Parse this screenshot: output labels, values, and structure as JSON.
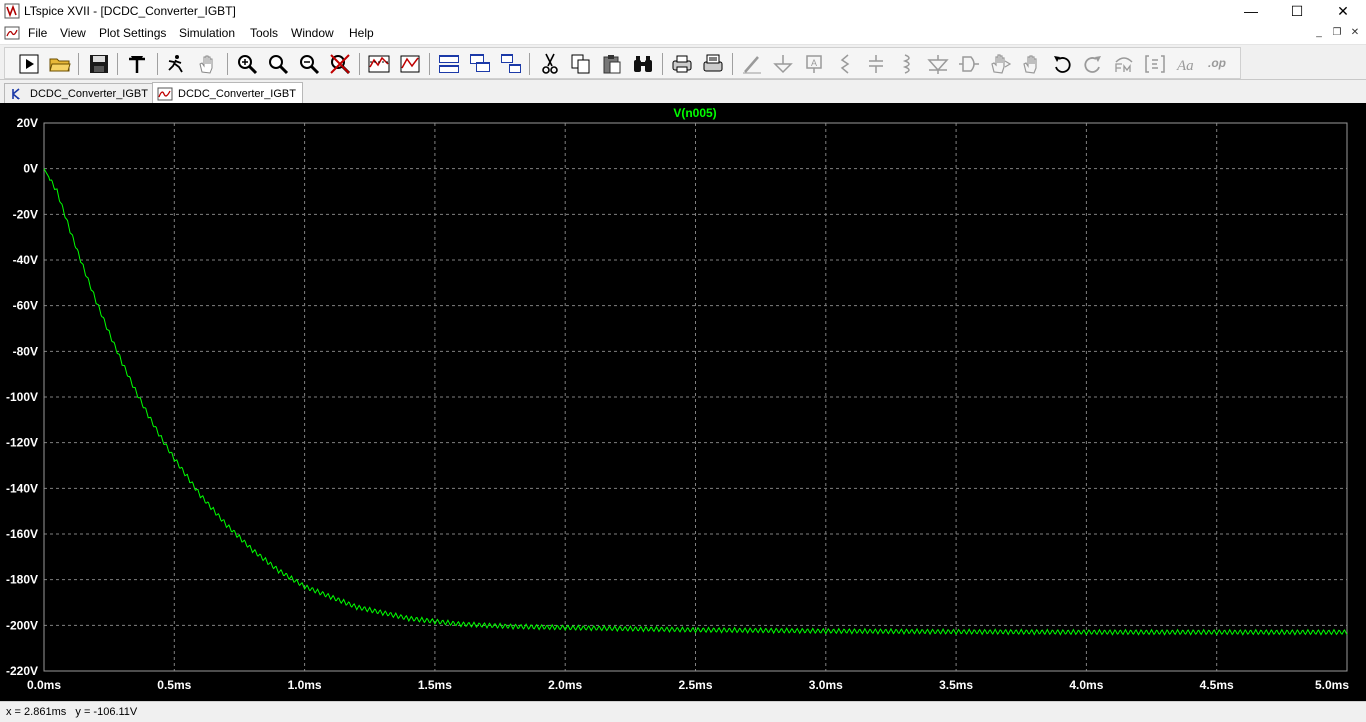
{
  "window": {
    "title": "LTspice XVII - [DCDC_Converter_IGBT]",
    "controls": {
      "minimize": "—",
      "maximize": "☐",
      "close": "✕"
    },
    "mdi_controls": {
      "minimize": "_",
      "restore": "❐",
      "close": "✕"
    }
  },
  "menu": {
    "items": [
      {
        "id": "file",
        "label": "File"
      },
      {
        "id": "view",
        "label": "View"
      },
      {
        "id": "plot-settings",
        "label": "Plot Settings"
      },
      {
        "id": "simulation",
        "label": "Simulation"
      },
      {
        "id": "tools",
        "label": "Tools"
      },
      {
        "id": "window",
        "label": "Window"
      },
      {
        "id": "help",
        "label": "Help"
      }
    ]
  },
  "toolbar": {
    "icons": [
      "run-icon",
      "open-folder-icon",
      "save-icon",
      "control-panel-icon",
      "halt-icon",
      "pan-hand-icon",
      "zoom-in-icon",
      "zoom-area-icon",
      "zoom-out-icon",
      "zoom-cancel-icon",
      "autorange-icon",
      "zoom-fit-icon",
      "tile-horizontal-icon",
      "cascade-icon",
      "tile-vertical-icon",
      "cut-icon",
      "copy-icon",
      "paste-icon",
      "find-icon",
      "print-icon",
      "print-setup-icon",
      "wire-icon",
      "ground-icon",
      "label-icon",
      "resistor-icon",
      "capacitor-icon",
      "inductor-icon",
      "diode-icon",
      "component-icon",
      "move-icon",
      "drag-icon",
      "undo-icon",
      "redo-icon",
      "rotate-icon",
      "mirror-icon",
      "text-icon",
      "spice-directive-icon"
    ]
  },
  "tabs": [
    {
      "label": "DCDC_Converter_IGBT",
      "icon": "schematic-icon",
      "active": false
    },
    {
      "label": "DCDC_Converter_IGBT",
      "icon": "waveform-icon",
      "active": true
    }
  ],
  "chart_data": {
    "type": "line",
    "title": "V(n005)",
    "xlabel": "",
    "ylabel": "",
    "xlim": [
      0,
      5.0
    ],
    "ylim": [
      -220,
      20
    ],
    "x_unit": "ms",
    "y_unit": "V",
    "x_ticks": [
      "0.0ms",
      "0.5ms",
      "1.0ms",
      "1.5ms",
      "2.0ms",
      "2.5ms",
      "3.0ms",
      "3.5ms",
      "4.0ms",
      "4.5ms",
      "5.0ms"
    ],
    "y_ticks": [
      "20V",
      "0V",
      "-20V",
      "-40V",
      "-60V",
      "-80V",
      "-100V",
      "-120V",
      "-140V",
      "-160V",
      "-180V",
      "-200V",
      "-220V"
    ],
    "grid": true,
    "background": "#000000",
    "grid_color": "#808080",
    "series": [
      {
        "name": "V(n005)",
        "color": "#00ff00",
        "x": [
          0,
          0.05,
          0.1,
          0.15,
          0.2,
          0.25,
          0.3,
          0.35,
          0.4,
          0.45,
          0.5,
          0.6,
          0.7,
          0.8,
          0.9,
          1.0,
          1.2,
          1.4,
          1.6,
          1.8,
          2.0,
          2.5,
          3.0,
          3.5,
          4.0,
          4.5,
          5.0
        ],
        "values": [
          0,
          -10,
          -27,
          -43,
          -58,
          -72,
          -85,
          -97,
          -108,
          -118,
          -127,
          -143,
          -156,
          -167,
          -176,
          -183,
          -192,
          -197,
          -199.5,
          -200.5,
          -201,
          -202,
          -202.5,
          -202.8,
          -203,
          -203,
          -203
        ]
      }
    ]
  },
  "status": {
    "readout": "x = 2.861ms   y = -106.11V"
  }
}
